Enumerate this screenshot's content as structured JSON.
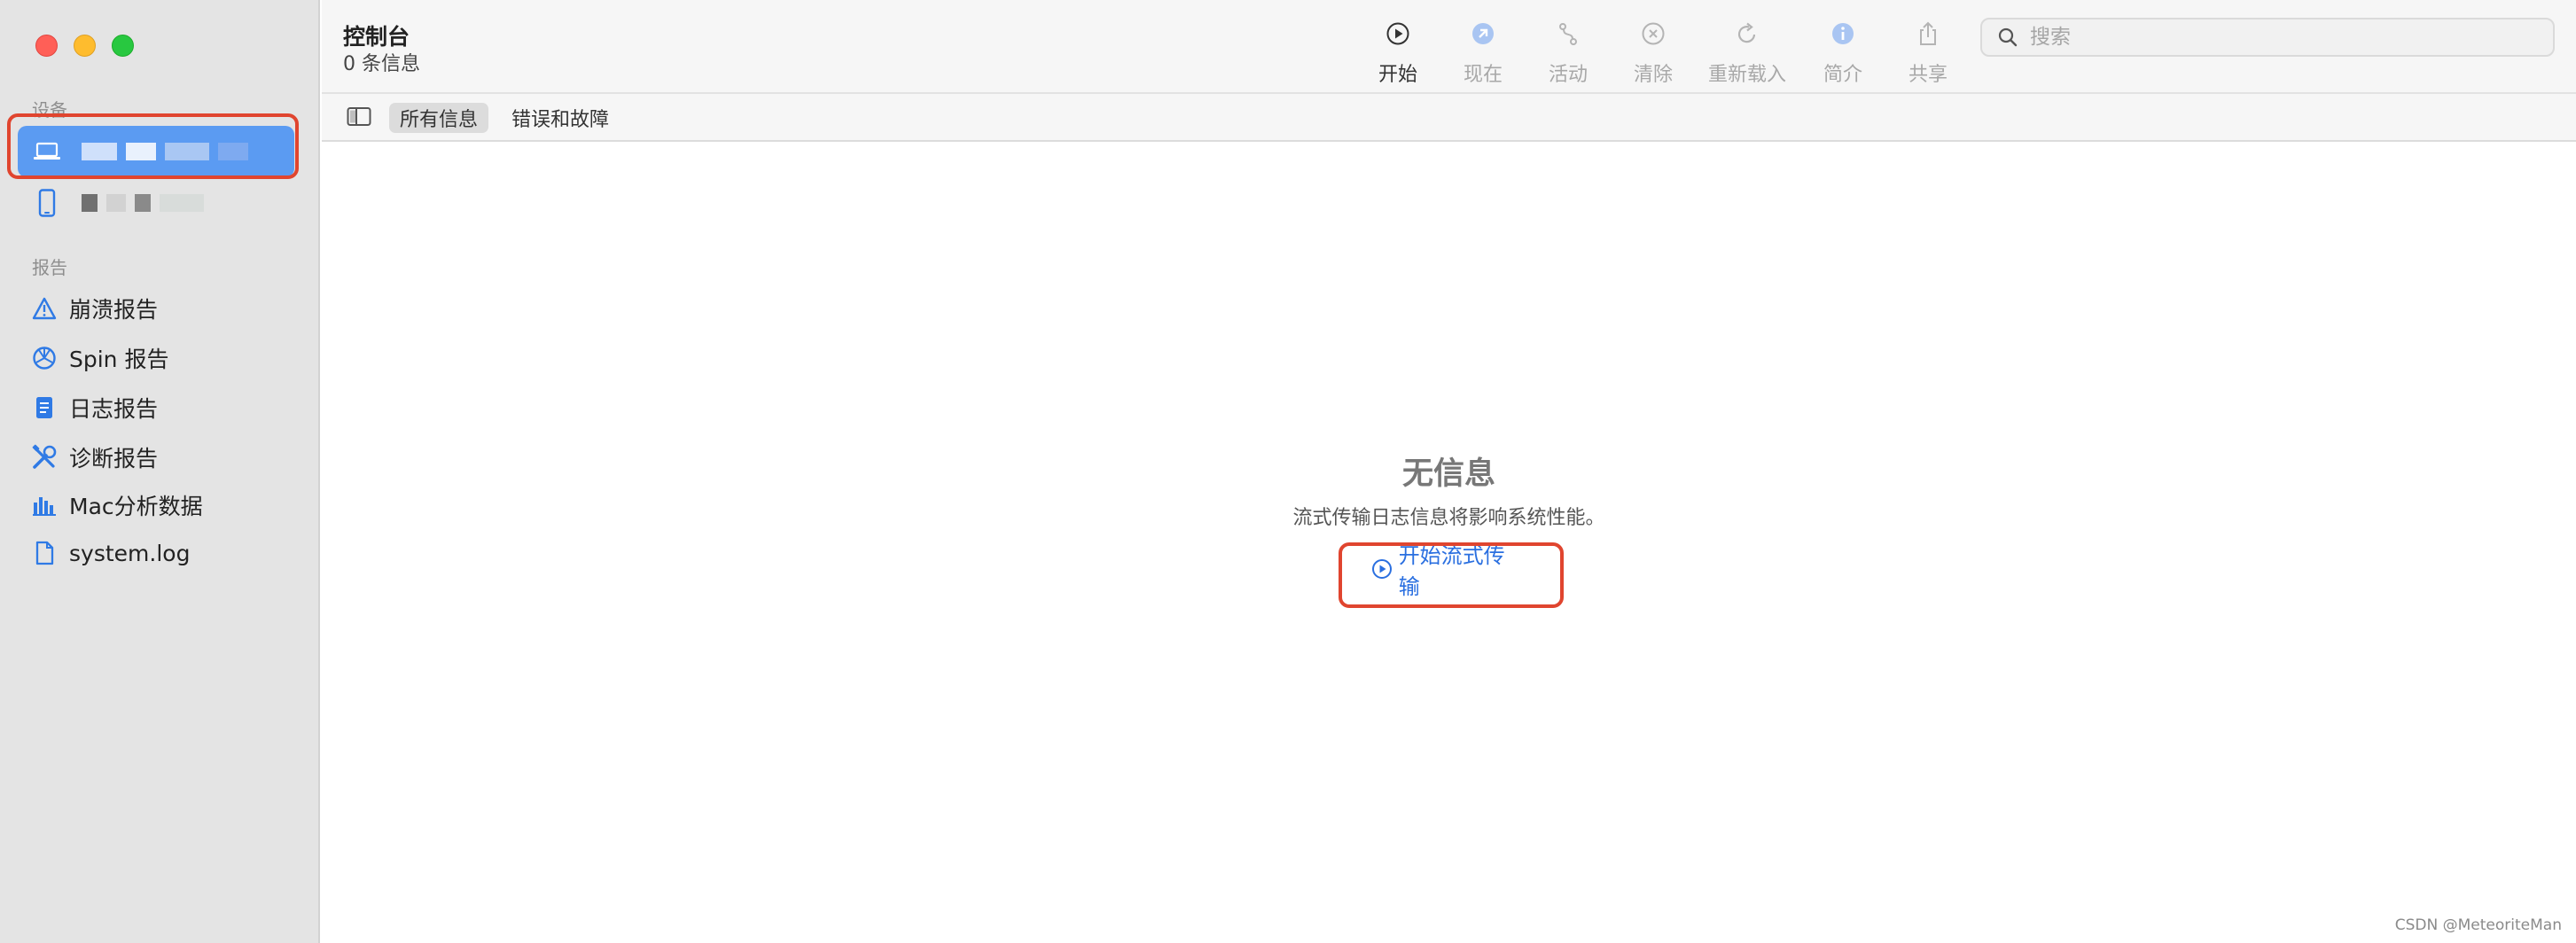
{
  "window": {
    "title": "控制台",
    "subtitle": "0 条信息"
  },
  "sidebar": {
    "devices_header": "设备",
    "reports_header": "报告",
    "devices": [
      {
        "icon": "laptop-icon",
        "selected": true
      },
      {
        "icon": "iphone-icon",
        "selected": false
      }
    ],
    "reports": [
      {
        "icon": "warning-triangle-icon",
        "label": "崩溃报告"
      },
      {
        "icon": "spin-icon",
        "label": "Spin 报告"
      },
      {
        "icon": "document-list-icon",
        "label": "日志报告"
      },
      {
        "icon": "tools-icon",
        "label": "诊断报告"
      },
      {
        "icon": "bar-chart-icon",
        "label": "Mac分析数据"
      },
      {
        "icon": "file-icon",
        "label": "system.log"
      }
    ]
  },
  "toolbar": {
    "start": "开始",
    "now": "现在",
    "activity": "活动",
    "clear": "清除",
    "reload": "重新载入",
    "info": "简介",
    "share": "共享"
  },
  "search": {
    "placeholder": "搜索",
    "value": ""
  },
  "filters": {
    "all": "所有信息",
    "errors": "错误和故障"
  },
  "empty_state": {
    "title": "无信息",
    "description": "流式传输日志信息将影响系统性能。",
    "button": "开始流式传输"
  },
  "watermark": "CSDN @MeteoriteMan",
  "colors": {
    "accent": "#2a6fe0",
    "selection": "#5b9bf2",
    "annotation": "#e0452f",
    "icon_blue": "#2f7ae5"
  }
}
